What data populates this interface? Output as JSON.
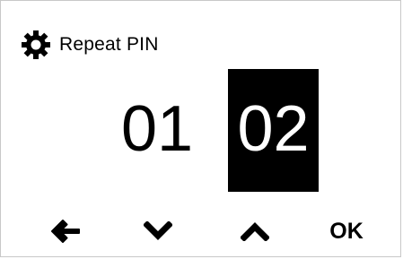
{
  "header": {
    "icon": "gear-icon",
    "title": "Repeat PIN"
  },
  "pin": {
    "digits": [
      "01",
      "02"
    ],
    "selected_index": 1
  },
  "softkeys": {
    "back_icon": "arrow-left-icon",
    "down_icon": "chevron-down-icon",
    "up_icon": "chevron-up-icon",
    "ok_label": "OK"
  },
  "colors": {
    "background": "#ffffff",
    "foreground": "#000000",
    "selected_bg": "#000000",
    "selected_fg": "#ffffff"
  }
}
